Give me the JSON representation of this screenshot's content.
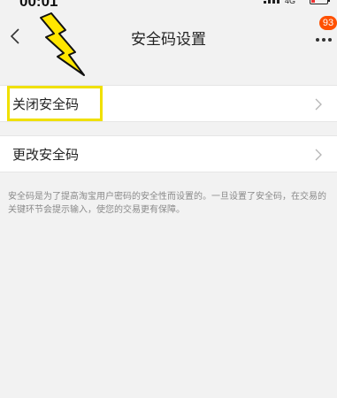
{
  "status_bar": {
    "time": "00:01",
    "network": "4G"
  },
  "nav": {
    "title": "安全码设置",
    "badge_count": "93"
  },
  "menu": {
    "close_label": "关闭安全码",
    "change_label": "更改安全码"
  },
  "description": "安全码是为了提高淘宝用户密码的安全性而设置的。一旦设置了安全码，在交易的关键环节会提示输入，使您的交易更有保障。",
  "icons": {
    "back": "chevron-left-icon",
    "more": "more-dots-icon",
    "row_arrow": "chevron-right-icon",
    "annotation": "lightning-bolt-icon"
  },
  "colors": {
    "background": "#f2f2f2",
    "badge": "#ff5000",
    "highlight": "#f0e000",
    "bolt": "#ffe600"
  }
}
